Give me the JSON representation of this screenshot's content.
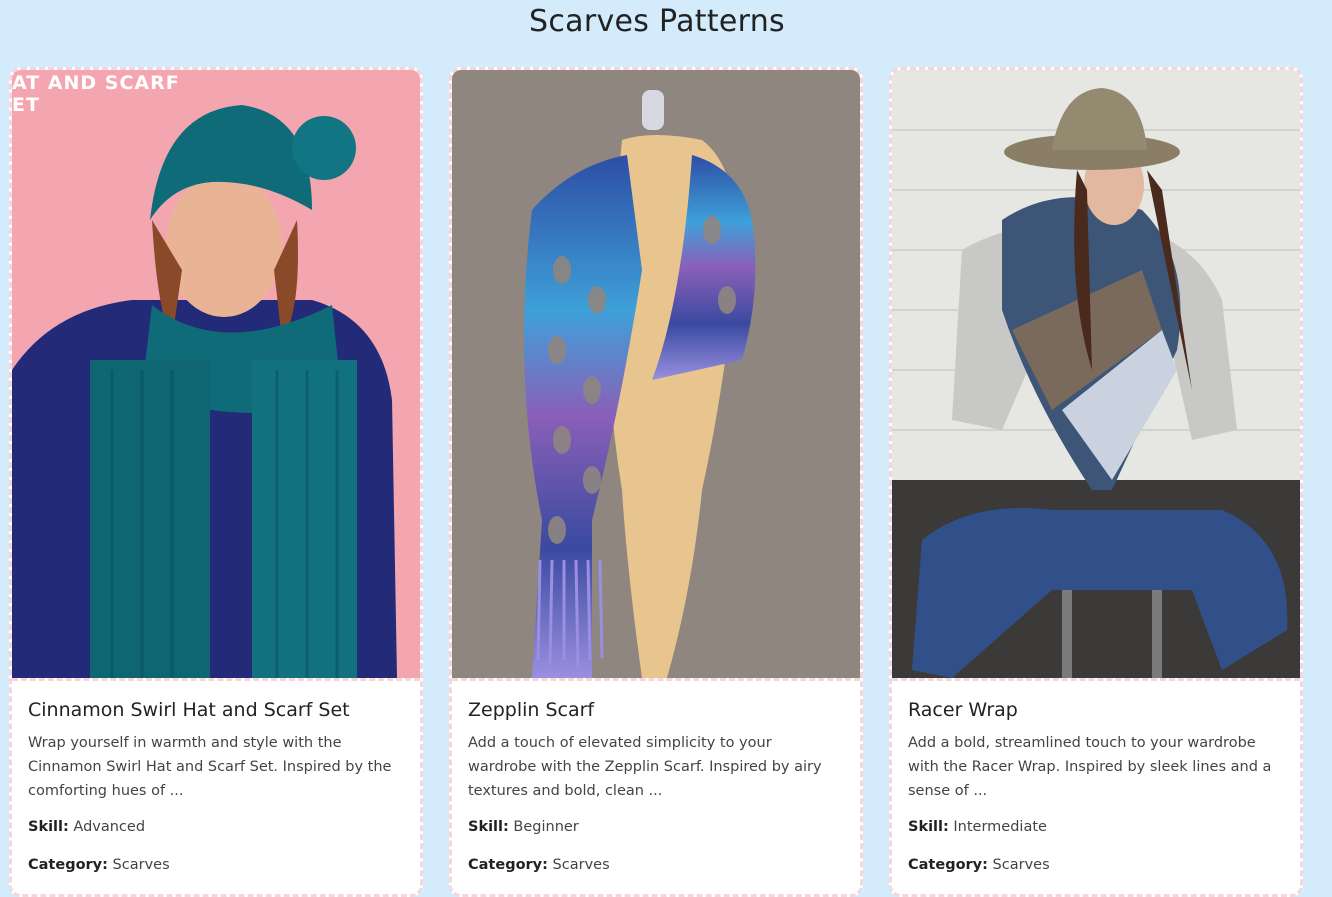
{
  "page": {
    "title": "Scarves Patterns"
  },
  "labels": {
    "skill": "Skill:",
    "category": "Category:"
  },
  "cards": [
    {
      "title": "Cinnamon Swirl Hat and Scarf Set",
      "description": "Wrap yourself in warmth and style with the Cinnamon Swirl Hat and Scarf Set. Inspired by the comforting hues of ...",
      "skill": "Advanced",
      "category": "Scarves",
      "image_overlay_text": "AT AND SCARF\nET",
      "image_bg": "#f4a6b0"
    },
    {
      "title": "Zepplin Scarf",
      "description": "Add a touch of elevated simplicity to your wardrobe with the Zepplin Scarf. Inspired by airy textures and bold, clean ...",
      "skill": "Beginner",
      "category": "Scarves",
      "image_bg": "#8f8680"
    },
    {
      "title": "Racer Wrap",
      "description": "Add a bold, streamlined touch to your wardrobe with the Racer Wrap. Inspired by sleek lines and a sense of ...",
      "skill": "Intermediate",
      "category": "Scarves",
      "image_bg": "#e6e6e3"
    }
  ],
  "colors": {
    "page_bg": "#d3ebfa",
    "card_border": "#f4d6dc",
    "teal_yarn": "#0f6b78",
    "text_dark": "#222222"
  }
}
